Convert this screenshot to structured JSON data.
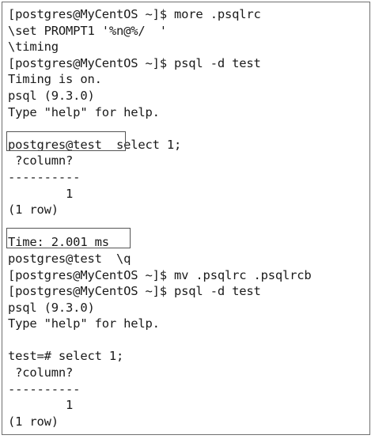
{
  "terminal": {
    "lines": [
      "[postgres@MyCentOS ~]$ more .psqlrc",
      "\\set PROMPT1 '%n@%/  '",
      "\\timing",
      "[postgres@MyCentOS ~]$ psql -d test",
      "Timing is on.",
      "psql (9.3.0)",
      "Type \"help\" for help.",
      "",
      "postgres@test  select 1;",
      " ?column?",
      "----------",
      "        1",
      "(1 row)",
      "",
      "Time: 2.001 ms",
      "postgres@test  \\q",
      "[postgres@MyCentOS ~]$ mv .psqlrc .psqlrcb",
      "[postgres@MyCentOS ~]$ psql -d test",
      "psql (9.3.0)",
      "Type \"help\" for help.",
      "",
      "test=# select 1;",
      " ?column?",
      "----------",
      "        1",
      "(1 row)"
    ]
  }
}
